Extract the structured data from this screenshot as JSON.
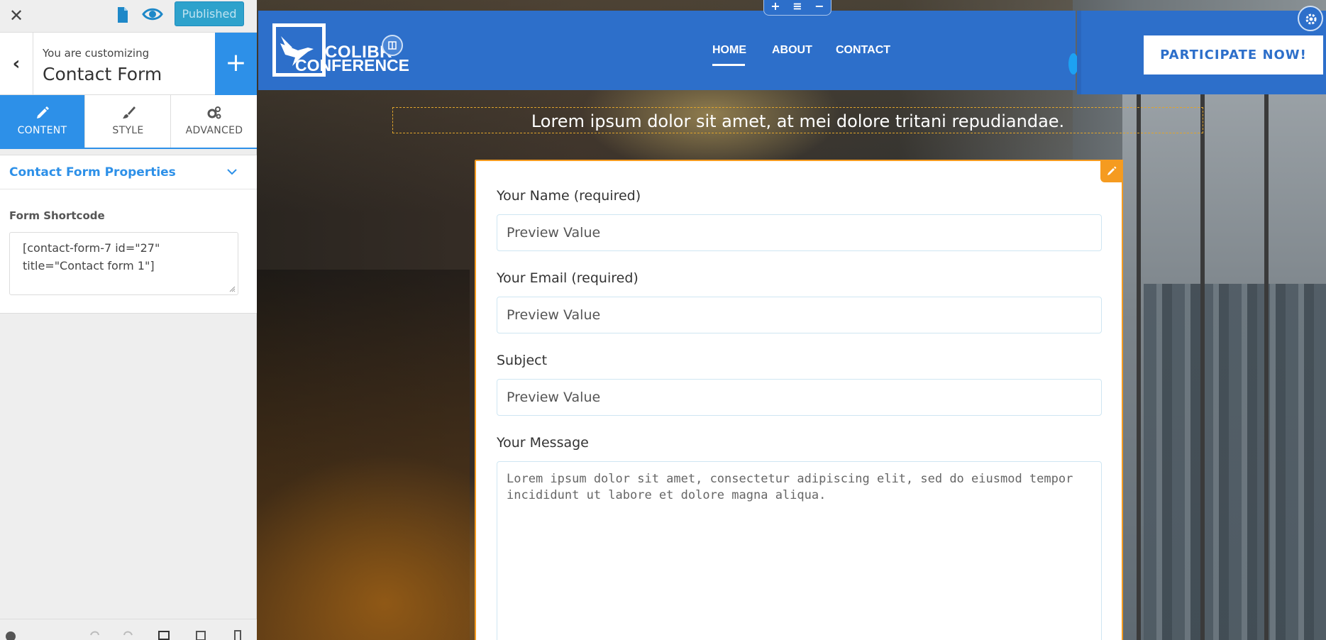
{
  "topbar": {
    "close_icon": "close-icon",
    "page_icon": "document-icon",
    "preview_icon": "eye-icon",
    "publish_label": "Published"
  },
  "customizing": {
    "label": "You are customizing",
    "title": "Contact Form",
    "add_label": "+"
  },
  "tabs": [
    {
      "label": "CONTENT",
      "icon": "pencil-icon",
      "active": true
    },
    {
      "label": "STYLE",
      "icon": "brush-icon",
      "active": false
    },
    {
      "label": "ADVANCED",
      "icon": "gears-icon",
      "active": false
    }
  ],
  "properties": {
    "title": "Contact Form Properties",
    "shortcode_label": "Form Shortcode",
    "shortcode_value": "[contact-form-7 id=\"27\" title=\"Contact form 1\"]"
  },
  "site": {
    "logo_text_line1": "COLIBR",
    "logo_text_line2": "CONFERENCE",
    "nav": [
      "HOME",
      "ABOUT",
      "CONTACT"
    ],
    "active_nav": "HOME",
    "cta_label": "PARTICIPATE NOW!",
    "tagline": "Lorem ipsum dolor sit amet, at mei dolore tritani repudiandae.",
    "section_controls": [
      "+",
      "≡",
      "−"
    ]
  },
  "form": {
    "fields": [
      {
        "label": "Your Name (required)",
        "value": "Preview Value"
      },
      {
        "label": "Your Email (required)",
        "value": "Preview Value"
      },
      {
        "label": "Subject",
        "value": "Preview Value"
      }
    ],
    "message_label": "Your Message",
    "message_value": "Lorem ipsum dolor sit amet, consectetur adipiscing elit, sed do eiusmod tempor incididunt ut labore et dolore magna aliqua."
  },
  "colors": {
    "accent_blue": "#2d90e8",
    "header_blue": "#2d6fca",
    "publish_blue": "#2ea2cc",
    "edit_orange": "#f59b20"
  }
}
